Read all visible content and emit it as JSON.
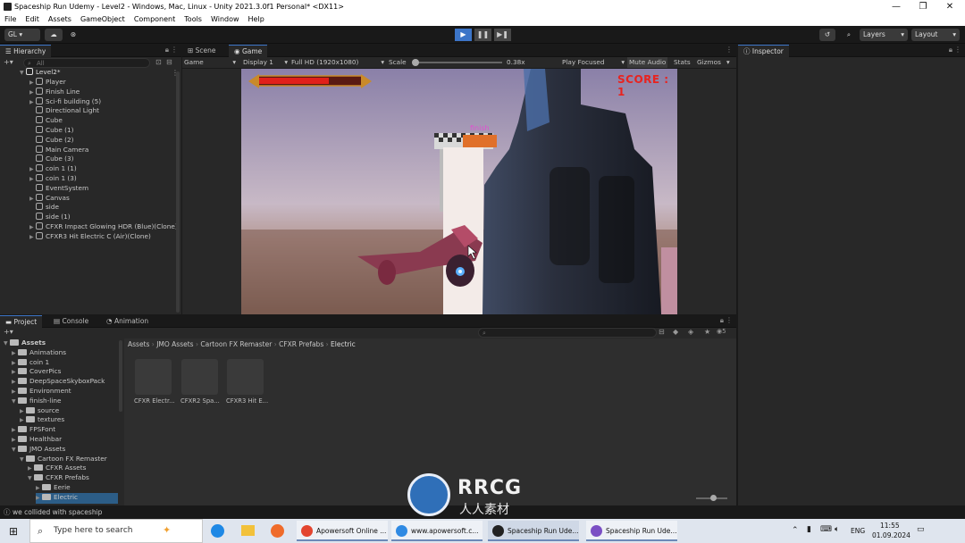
{
  "window": {
    "title": "Spaceship Run Udemy - Level2 - Windows, Mac, Linux - Unity 2021.3.0f1 Personal* <DX11>",
    "controls": [
      "—",
      "❐",
      "✕"
    ]
  },
  "menu": [
    "File",
    "Edit",
    "Assets",
    "GameObject",
    "Component",
    "Tools",
    "Window",
    "Help"
  ],
  "toolbar": {
    "account": "GL ▾",
    "layers": "Layers",
    "layout": "Layout"
  },
  "hierarchy": {
    "tab": "Hierarchy",
    "search_placeholder": "All",
    "scene": "Level2*",
    "items": [
      {
        "label": "Player",
        "expandable": true
      },
      {
        "label": "Finish Line",
        "expandable": true
      },
      {
        "label": "Sci-fi building (5)",
        "expandable": true
      },
      {
        "label": "Directional Light",
        "expandable": false
      },
      {
        "label": "Cube",
        "expandable": false
      },
      {
        "label": "Cube (1)",
        "expandable": false
      },
      {
        "label": "Cube (2)",
        "expandable": false
      },
      {
        "label": "Main Camera",
        "expandable": false
      },
      {
        "label": "Cube (3)",
        "expandable": false
      },
      {
        "label": "coin 1 (1)",
        "expandable": true
      },
      {
        "label": "coin 1 (3)",
        "expandable": true
      },
      {
        "label": "EventSystem",
        "expandable": false
      },
      {
        "label": "Canvas",
        "expandable": true
      },
      {
        "label": "side",
        "expandable": false
      },
      {
        "label": "side (1)",
        "expandable": false
      },
      {
        "label": "CFXR Impact Glowing HDR (Blue)(Clone)",
        "expandable": true
      },
      {
        "label": "CFXR3 Hit Electric C (Air)(Clone)",
        "expandable": true
      }
    ]
  },
  "game_view": {
    "tabs": [
      "Scene",
      "Game"
    ],
    "mode": "Game",
    "display": "Display 1",
    "resolution": "Full HD (1920x1080)",
    "scale_label": "Scale",
    "scale_value": "0.38x",
    "play_focused": "Play Focused",
    "mute": "Mute Audio",
    "stats": "Stats",
    "gizmos": "Gizmos",
    "score": "SCORE : 1",
    "finish_sign": "finish"
  },
  "inspector": {
    "tab": "Inspector"
  },
  "project": {
    "tabs": [
      "Project",
      "Console",
      "Animation"
    ],
    "breadcrumb": [
      "Assets",
      "JMO Assets",
      "Cartoon FX Remaster",
      "CFXR Prefabs",
      "Electric"
    ],
    "tree": [
      {
        "label": "Assets",
        "depth": 0,
        "open": true
      },
      {
        "label": "Animations",
        "depth": 1
      },
      {
        "label": "coin 1",
        "depth": 1
      },
      {
        "label": "CoverPics",
        "depth": 1
      },
      {
        "label": "DeepSpaceSkyboxPack",
        "depth": 1
      },
      {
        "label": "Environment",
        "depth": 1
      },
      {
        "label": "finish-line",
        "depth": 1,
        "open": true
      },
      {
        "label": "source",
        "depth": 2
      },
      {
        "label": "textures",
        "depth": 2
      },
      {
        "label": "FPSFont",
        "depth": 1
      },
      {
        "label": "Healthbar",
        "depth": 1
      },
      {
        "label": "JMO Assets",
        "depth": 1,
        "open": true
      },
      {
        "label": "Cartoon FX Remaster",
        "depth": 2,
        "open": true
      },
      {
        "label": "CFXR Assets",
        "depth": 3
      },
      {
        "label": "CFXR Prefabs",
        "depth": 3,
        "open": true
      },
      {
        "label": "Eerie",
        "depth": 4
      },
      {
        "label": "Electric",
        "depth": 4,
        "selected": true
      }
    ],
    "assets": [
      "CFXR Electr...",
      "CFXR2 Spa...",
      "CFXR3 Hit E..."
    ],
    "count_badge": "5"
  },
  "status": {
    "message": "we collided with spaceship"
  },
  "watermark": {
    "brand": "RRCG",
    "sub": "人人素材"
  },
  "taskbar": {
    "search_placeholder": "Type here to search",
    "apps": [
      {
        "label": "Apowersoft Online ...",
        "color": "#e3452f"
      },
      {
        "label": "www.apowersoft.c...",
        "color": "#2f8ae3"
      },
      {
        "label": "Spaceship Run Ude...",
        "color": "#222222"
      },
      {
        "label": "Spaceship Run Ude...",
        "color": "#7b4fc4"
      }
    ],
    "lang": "ENG",
    "time": "11:55",
    "date": "01.09.2024"
  },
  "colors": {
    "accent": "#3c75c8",
    "score": "#e8231f"
  }
}
